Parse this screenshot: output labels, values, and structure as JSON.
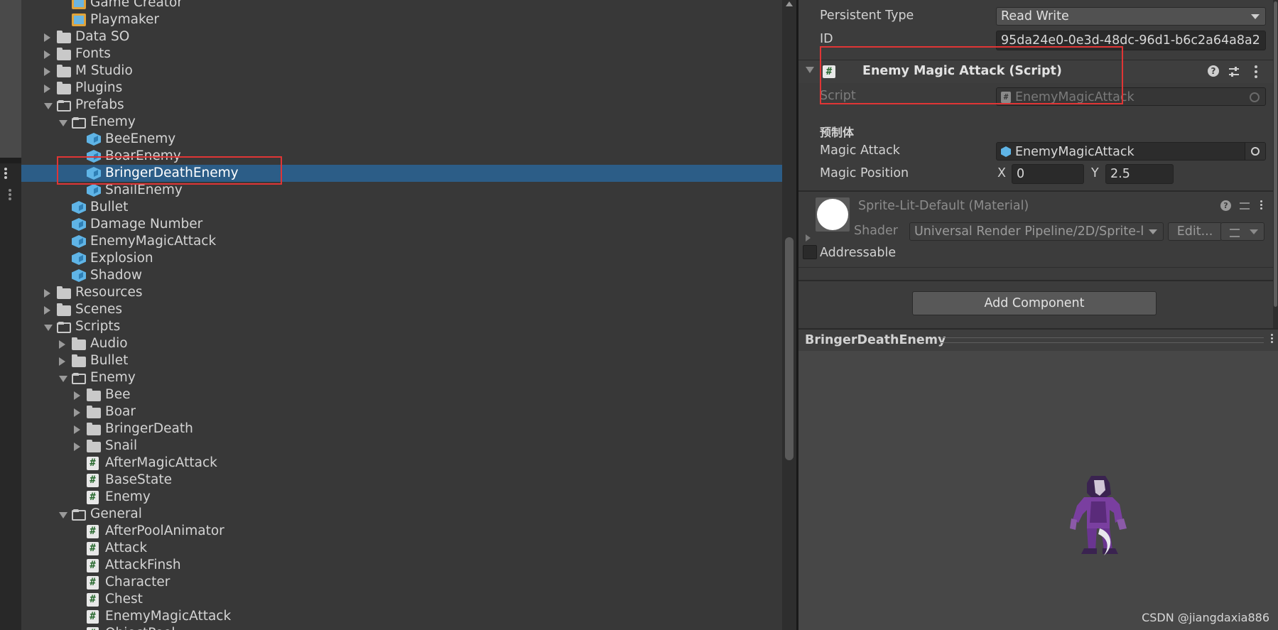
{
  "project_tree": {
    "items": [
      {
        "label": "Game Creator",
        "icon": "package-icon",
        "indent": 2,
        "expander": "none"
      },
      {
        "label": "Playmaker",
        "icon": "package-icon",
        "indent": 2,
        "expander": "none"
      },
      {
        "label": "Data SO",
        "icon": "folder-icon",
        "indent": 1,
        "expander": "collapsed"
      },
      {
        "label": "Fonts",
        "icon": "folder-icon",
        "indent": 1,
        "expander": "collapsed"
      },
      {
        "label": "M Studio",
        "icon": "folder-icon",
        "indent": 1,
        "expander": "collapsed"
      },
      {
        "label": "Plugins",
        "icon": "folder-icon",
        "indent": 1,
        "expander": "collapsed"
      },
      {
        "label": "Prefabs",
        "icon": "folder-open-icon",
        "indent": 1,
        "expander": "expanded"
      },
      {
        "label": "Enemy",
        "icon": "folder-open-icon",
        "indent": 2,
        "expander": "expanded"
      },
      {
        "label": "BeeEnemy",
        "icon": "prefab-icon",
        "indent": 3,
        "expander": "none"
      },
      {
        "label": "BoarEnemy",
        "icon": "prefab-icon",
        "indent": 3,
        "expander": "none"
      },
      {
        "label": "BringerDeathEnemy",
        "icon": "prefab-icon",
        "indent": 3,
        "expander": "none",
        "selected": true
      },
      {
        "label": "SnailEnemy",
        "icon": "prefab-icon",
        "indent": 3,
        "expander": "none"
      },
      {
        "label": "Bullet",
        "icon": "prefab-icon",
        "indent": 2,
        "expander": "none"
      },
      {
        "label": "Damage Number",
        "icon": "prefab-icon",
        "indent": 2,
        "expander": "none"
      },
      {
        "label": "EnemyMagicAttack",
        "icon": "prefab-icon",
        "indent": 2,
        "expander": "none"
      },
      {
        "label": "Explosion",
        "icon": "prefab-icon",
        "indent": 2,
        "expander": "none"
      },
      {
        "label": "Shadow",
        "icon": "prefab-icon",
        "indent": 2,
        "expander": "none"
      },
      {
        "label": "Resources",
        "icon": "folder-icon",
        "indent": 1,
        "expander": "collapsed"
      },
      {
        "label": "Scenes",
        "icon": "folder-icon",
        "indent": 1,
        "expander": "collapsed"
      },
      {
        "label": "Scripts",
        "icon": "folder-open-icon",
        "indent": 1,
        "expander": "expanded"
      },
      {
        "label": "Audio",
        "icon": "folder-icon",
        "indent": 2,
        "expander": "collapsed"
      },
      {
        "label": "Bullet",
        "icon": "folder-icon",
        "indent": 2,
        "expander": "collapsed"
      },
      {
        "label": "Enemy",
        "icon": "folder-open-icon",
        "indent": 2,
        "expander": "expanded"
      },
      {
        "label": "Bee",
        "icon": "folder-icon",
        "indent": 3,
        "expander": "collapsed"
      },
      {
        "label": "Boar",
        "icon": "folder-icon",
        "indent": 3,
        "expander": "collapsed"
      },
      {
        "label": "BringerDeath",
        "icon": "folder-icon",
        "indent": 3,
        "expander": "collapsed"
      },
      {
        "label": "Snail",
        "icon": "folder-icon",
        "indent": 3,
        "expander": "collapsed"
      },
      {
        "label": "AfterMagicAttack",
        "icon": "script-icon",
        "indent": 3,
        "expander": "none"
      },
      {
        "label": "BaseState",
        "icon": "script-icon",
        "indent": 3,
        "expander": "none"
      },
      {
        "label": "Enemy",
        "icon": "script-icon",
        "indent": 3,
        "expander": "none"
      },
      {
        "label": "General",
        "icon": "folder-open-icon",
        "indent": 2,
        "expander": "expanded"
      },
      {
        "label": "AfterPoolAnimator",
        "icon": "script-icon",
        "indent": 3,
        "expander": "none"
      },
      {
        "label": "Attack",
        "icon": "script-icon",
        "indent": 3,
        "expander": "none"
      },
      {
        "label": "AttackFinsh",
        "icon": "script-icon",
        "indent": 3,
        "expander": "none"
      },
      {
        "label": "Character",
        "icon": "script-icon",
        "indent": 3,
        "expander": "none"
      },
      {
        "label": "Chest",
        "icon": "script-icon",
        "indent": 3,
        "expander": "none"
      },
      {
        "label": "EnemyMagicAttack",
        "icon": "script-icon",
        "indent": 3,
        "expander": "none"
      },
      {
        "label": "ObjectPool",
        "icon": "script-icon",
        "indent": 3,
        "expander": "none"
      }
    ]
  },
  "inspector": {
    "persistent_type_label": "Persistent Type",
    "persistent_type_value": "Read Write",
    "id_label": "ID",
    "id_value": "95da24e0-0e3d-48dc-96d1-b6c2a64a8a2",
    "component_title": "Enemy Magic Attack (Script)",
    "script_label": "Script",
    "script_value": "EnemyMagicAttack",
    "section_header": "预制体",
    "magic_attack_label": "Magic Attack",
    "magic_attack_value": "EnemyMagicAttack",
    "magic_position_label": "Magic Position",
    "x_label": "X",
    "x_value": "0",
    "y_label": "Y",
    "y_value": "2.5",
    "material_title": "Sprite-Lit-Default (Material)",
    "shader_label": "Shader",
    "shader_value": "Universal Render Pipeline/2D/Sprite-l",
    "edit_button": "Edit...",
    "addressable_label": "Addressable",
    "addressable_checked": false,
    "add_component_button": "Add Component",
    "help_glyph": "?"
  },
  "preview": {
    "title": "BringerDeathEnemy",
    "watermark": "CSDN @jiangdaxia886"
  },
  "colors": {
    "selection": "#2c5d87",
    "highlight_box": "#e03535",
    "prefab_icon": "#5fb4e6",
    "character_purple": "#7a3fa0"
  }
}
